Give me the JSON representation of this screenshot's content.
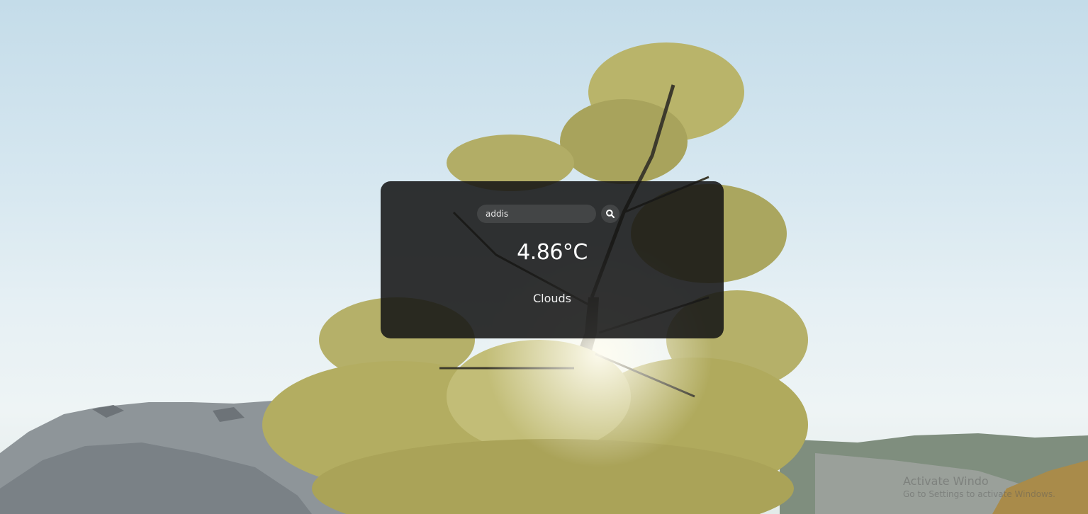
{
  "search": {
    "value": "addis",
    "placeholder": ""
  },
  "weather": {
    "temperature": "4.86°C",
    "description": "Clouds"
  },
  "watermark": {
    "line1": "Activate Windo",
    "line2": "Go to Settings to activate Windows."
  },
  "colors": {
    "card_bg": "#161616",
    "text": "#ffffff",
    "sky": "#d6e7f0",
    "foliage": "#b9b46a",
    "rock": "#8e9599"
  },
  "icons": {
    "search_button": "search-icon"
  }
}
